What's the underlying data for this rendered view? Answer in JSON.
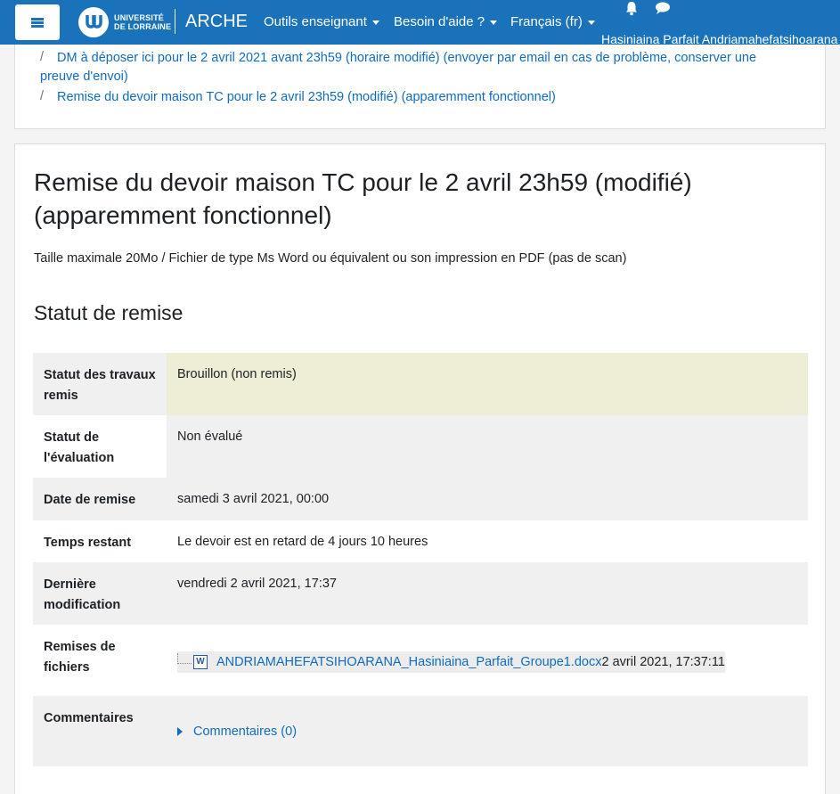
{
  "navbar": {
    "logo_line1": "UNIVERSITÉ",
    "logo_line2": "DE LORRAINE",
    "app_name": "ARCHE",
    "menu_teacher_tools": "Outils enseignant",
    "menu_help": "Besoin d'aide ?",
    "menu_language": "Français (fr)",
    "user_name": "Hasiniaina Parfait Andriamahefatsihoarana",
    "icons": [
      "menu-icon",
      "bell-icon",
      "chat-icon"
    ]
  },
  "breadcrumb": {
    "item1_line1": "DM à déposer ici pour le 2 avril 2021 avant 23h59 (horaire modifié) (envoyer par email en cas de problème, conserver une",
    "item1_line2": "preuve d'envoi)",
    "item2": "Remise du devoir maison TC pour le 2 avril 23h59 (modifié) (apparemment fonctionnel)",
    "separator": "/"
  },
  "page": {
    "title": "Remise du devoir maison TC pour le 2 avril 23h59 (modifié) (apparemment fonctionnel)",
    "intro": "Taille maximale 20Mo / Fichier de type Ms Word ou équivalent ou son impression en PDF (pas de scan)",
    "section_title": "Statut de remise"
  },
  "status": {
    "submission_status_label": "Statut des travaux remis",
    "submission_status_value": "Brouillon (non remis)",
    "grading_status_label": "Statut de l'évaluation",
    "grading_status_value": "Non évalué",
    "due_date_label": "Date de remise",
    "due_date_value": "samedi 3 avril 2021, 00:00",
    "time_remaining_label": "Temps restant",
    "time_remaining_value": "Le devoir est en retard de 4 jours 10 heures",
    "last_modified_label": "Dernière modification",
    "last_modified_value": "vendredi 2 avril 2021, 17:37",
    "file_submissions_label": "Remises de fichiers",
    "file_name": "ANDRIAMAHEFATSIHOARANA_Hasiniaina_Parfait_Groupe1.docx",
    "file_date": "2 avril 2021, 17:37:11",
    "comments_label": "Commentaires",
    "comments_link": "Commentaires (0)"
  },
  "colors": {
    "navbar": "#1a73ba",
    "link": "#0f6cbf",
    "draft_bg": "#eeeed7",
    "late_text": "#f0a247"
  }
}
